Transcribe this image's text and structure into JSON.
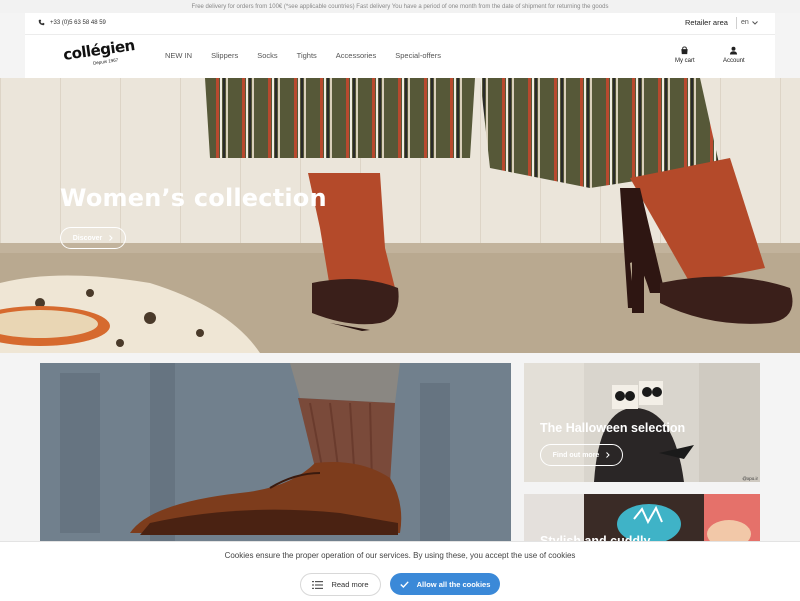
{
  "announcement": "Free delivery for orders from 100€ (*see applicable countries) Fast delivery You have a period of one month from the date of shipment for returning the goods",
  "header": {
    "phone": "+33 (0)5 63 58 48 59",
    "retailer_area": "Retailer area",
    "language": "en",
    "logo_text": "collégien",
    "logo_since": "Depuis 1967",
    "nav": [
      "NEW IN",
      "Slippers",
      "Socks",
      "Tights",
      "Accessories",
      "Special-offers"
    ],
    "cart_label": "My cart",
    "account_label": "Account"
  },
  "hero": {
    "title": "Women’s collection",
    "button": "Discover"
  },
  "tiles": {
    "halloween_title": "The Halloween selection",
    "halloween_button": "Find out more",
    "halloween_credit": "@xpo.ir",
    "second_title": "Stylish and cuddly"
  },
  "cookie": {
    "text": "Cookies ensure the proper operation of our services. By using these, you accept the use of cookies",
    "read_more": "Read more",
    "allow": "Allow all the cookies"
  },
  "colors": {
    "accent_blue": "#3b89d8"
  }
}
